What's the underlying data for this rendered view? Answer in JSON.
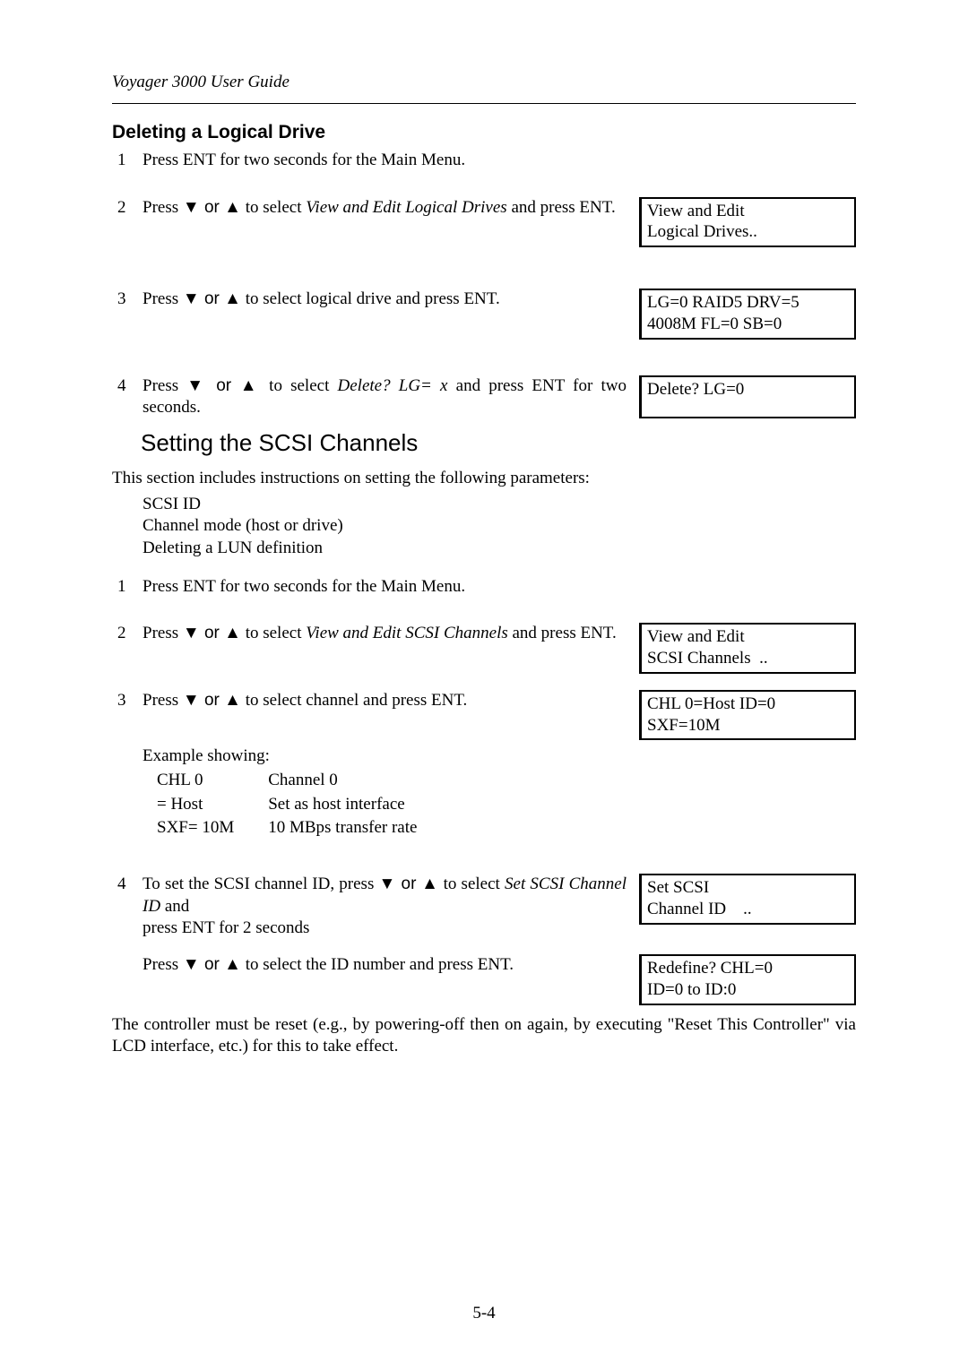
{
  "running_header": "Voyager 3000 User Guide",
  "page_number": "5-4",
  "section_a": {
    "title": "Deleting a Logical Drive",
    "steps": [
      {
        "num": "1",
        "text": "Press ENT for two seconds for the Main Menu."
      },
      {
        "num": "2",
        "pre": "Press ",
        "arrows": "▼ or ▲",
        "mid": " to select ",
        "italic": "View and Edit Logical Drives",
        "post": " and press ENT.",
        "lcd": [
          "View and Edit",
          "Logical Drives.."
        ]
      },
      {
        "num": "3",
        "pre": "Press ",
        "arrows": "▼ or ▲",
        "post": " to select logical drive and press ENT.",
        "lcd": [
          "LG=0 RAID5 DRV=5",
          "4008M FL=0 SB=0"
        ]
      },
      {
        "num": "4",
        "pre": "Press ",
        "arrows": "▼ or ▲",
        "mid": " to select ",
        "italic": "Delete? LG= x",
        "post": " and press ENT for two seconds.",
        "lcd": [
          "Delete? LG=0",
          ""
        ]
      }
    ]
  },
  "section_b": {
    "title": "Setting the SCSI Channels",
    "intro": "This section includes instructions on setting the following parameters:",
    "params": [
      "SCSI ID",
      "Channel mode (host or drive)",
      "Deleting a LUN definition"
    ],
    "steps": [
      {
        "num": "1",
        "text": "Press ENT for two seconds for the Main Menu."
      },
      {
        "num": "2",
        "pre": "Press ",
        "arrows": "▼ or ▲",
        "mid": " to select ",
        "italic": "View and Edit SCSI Channels",
        "post": " and press ENT.",
        "lcd": [
          "View and Edit",
          "SCSI Channels  .."
        ]
      },
      {
        "num": "3",
        "pre": "Press ",
        "arrows": "▼ or ▲",
        "post": " to select channel and press ENT.",
        "lcd": [
          "CHL 0=Host ID=0",
          "SXF=10M"
        ]
      }
    ],
    "example_label": "Example showing:",
    "example_rows": [
      {
        "c1": "CHL 0",
        "c2": "Channel 0"
      },
      {
        "c1": "= Host",
        "c2": "Set as host interface"
      },
      {
        "c1": "SXF= 10M",
        "c2": "10 MBps transfer rate"
      }
    ],
    "step4": {
      "num": "4",
      "pre": "To set the SCSI channel ID, press ",
      "arrows": "▼ or ▲",
      "mid": " to select ",
      "italic": "Set SCSI Channel ID",
      "post1": " and",
      "post2": "press ENT for 2 seconds",
      "lcd": [
        "Set SCSI",
        "Channel ID    .."
      ],
      "sub_pre": "Press ",
      "sub_arrows": "▼ or ▲",
      "sub_post": " to select the ID number and press ENT.",
      "sub_lcd": [
        "Redefine? CHL=0",
        "ID=0 to ID:0"
      ]
    },
    "note": "The controller must be reset (e.g., by powering-off then on again, by executing \"Reset This Controller\" via LCD interface, etc.) for this to take effect."
  }
}
